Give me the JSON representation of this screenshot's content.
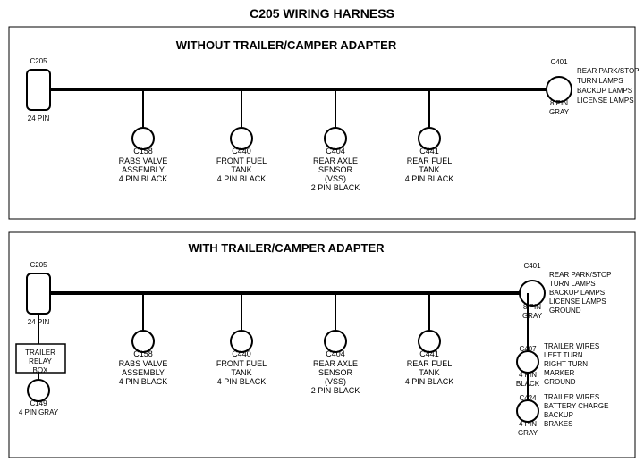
{
  "title": "C205 WIRING HARNESS",
  "top_section": {
    "label": "WITHOUT TRAILER/CAMPER ADAPTER",
    "left_connector": {
      "name": "C205",
      "sub": "24 PIN"
    },
    "right_connector": {
      "name": "C401",
      "sub": "8 PIN",
      "color": "GRAY",
      "side_labels": [
        "REAR PARK/STOP",
        "TURN LAMPS",
        "BACKUP LAMPS",
        "LICENSE LAMPS"
      ]
    },
    "connectors": [
      {
        "name": "C158",
        "labels": [
          "RABS VALVE",
          "ASSEMBLY",
          "4 PIN BLACK"
        ]
      },
      {
        "name": "C440",
        "labels": [
          "FRONT FUEL",
          "TANK",
          "4 PIN BLACK"
        ]
      },
      {
        "name": "C404",
        "labels": [
          "REAR AXLE",
          "SENSOR",
          "(VSS)",
          "2 PIN BLACK"
        ]
      },
      {
        "name": "C441",
        "labels": [
          "REAR FUEL",
          "TANK",
          "4 PIN BLACK"
        ]
      }
    ]
  },
  "bottom_section": {
    "label": "WITH TRAILER/CAMPER ADAPTER",
    "left_connector": {
      "name": "C205",
      "sub": "24 PIN"
    },
    "right_connector": {
      "name": "C401",
      "sub": "8 PIN",
      "color": "GRAY",
      "side_labels": [
        "REAR PARK/STOP",
        "TURN LAMPS",
        "BACKUP LAMPS",
        "LICENSE LAMPS",
        "GROUND"
      ]
    },
    "extra_left": {
      "box_label": "TRAILER\nRELAY\nBOX",
      "connector": {
        "name": "C149",
        "sub": "4 PIN GRAY"
      }
    },
    "connectors": [
      {
        "name": "C158",
        "labels": [
          "RABS VALVE",
          "ASSEMBLY",
          "4 PIN BLACK"
        ]
      },
      {
        "name": "C440",
        "labels": [
          "FRONT FUEL",
          "TANK",
          "4 PIN BLACK"
        ]
      },
      {
        "name": "C404",
        "labels": [
          "REAR AXLE",
          "SENSOR",
          "(VSS)",
          "2 PIN BLACK"
        ]
      },
      {
        "name": "C441",
        "labels": [
          "REAR FUEL",
          "TANK",
          "4 PIN BLACK"
        ]
      }
    ],
    "right_extra_connectors": [
      {
        "name": "C407",
        "sub": "4 PIN\nBLACK",
        "side_labels": [
          "TRAILER WIRES",
          "LEFT TURN",
          "RIGHT TURN",
          "MARKER",
          "GROUND"
        ]
      },
      {
        "name": "C424",
        "sub": "4 PIN\nGRAY",
        "side_labels": [
          "TRAILER WIRES",
          "BATTERY CHARGE",
          "BACKUP",
          "BRAKES"
        ]
      }
    ]
  }
}
